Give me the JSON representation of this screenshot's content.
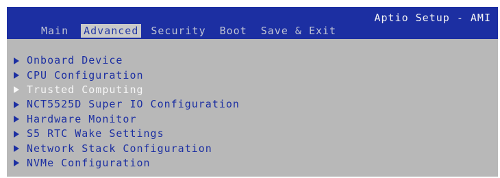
{
  "header": {
    "brand": "Aptio Setup - AMI"
  },
  "tabs": [
    {
      "label": "Main"
    },
    {
      "label": "Advanced"
    },
    {
      "label": "Security"
    },
    {
      "label": "Boot"
    },
    {
      "label": "Save & Exit"
    }
  ],
  "active_tab": "Advanced",
  "menu": {
    "items": [
      {
        "label": "Onboard Device",
        "icon": "right-triangle-icon"
      },
      {
        "label": "CPU Configuration",
        "icon": "right-triangle-icon"
      },
      {
        "label": "Trusted Computing",
        "icon": "right-triangle-icon",
        "selected": true
      },
      {
        "label": "NCT5525D Super IO Configuration",
        "icon": "right-triangle-icon"
      },
      {
        "label": "Hardware Monitor",
        "icon": "right-triangle-icon"
      },
      {
        "label": "S5 RTC Wake Settings",
        "icon": "right-triangle-icon"
      },
      {
        "label": "Network Stack Configuration",
        "icon": "right-triangle-icon"
      },
      {
        "label": "NVMe Configuration",
        "icon": "right-triangle-icon"
      }
    ]
  },
  "colors": {
    "header_background": "#1c2fa2",
    "content_background": "#b8b8b8",
    "menu_text": "#1c2fa2",
    "selected_text": "#f7f7f7",
    "active_tab_background": "#c9c9c9"
  }
}
